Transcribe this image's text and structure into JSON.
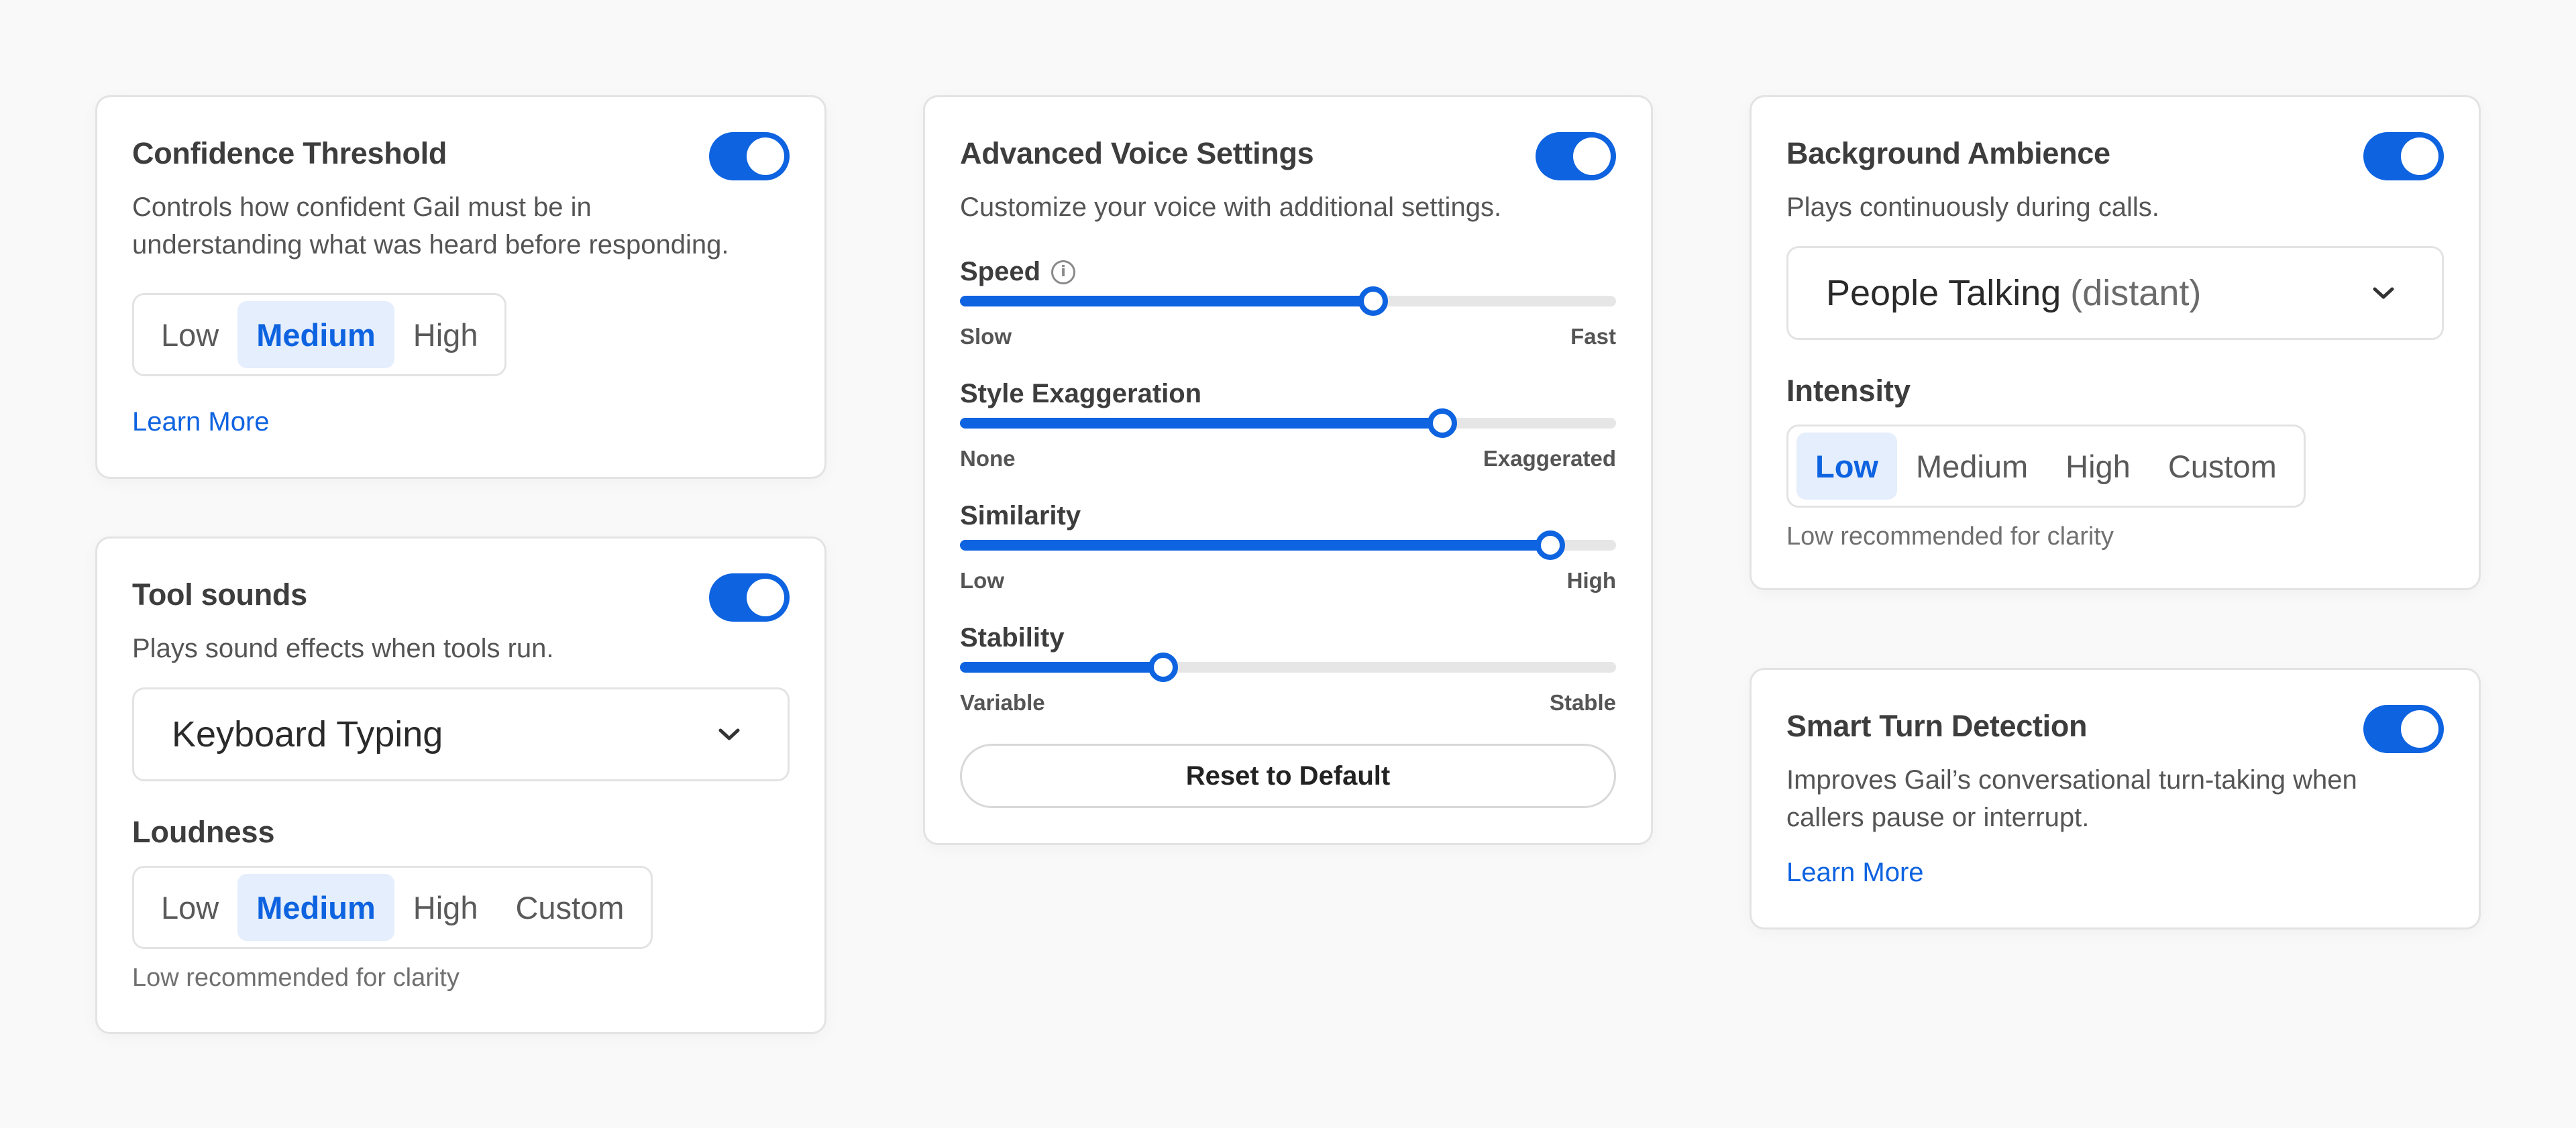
{
  "colors": {
    "accent": "#0e63e0",
    "accent_light": "#e4eefc",
    "background": "#f9f9f9",
    "card_border": "#e3e3e3"
  },
  "confidence": {
    "title": "Confidence Threshold",
    "enabled": true,
    "description": "Controls how confident Gail must be in\nunderstanding what was heard before responding.",
    "options": [
      "Low",
      "Medium",
      "High"
    ],
    "selected": "Medium",
    "learn_more": "Learn More"
  },
  "tool_sounds": {
    "title": "Tool sounds",
    "enabled": true,
    "description": "Plays sound effects when tools run.",
    "sound": "Keyboard Typing",
    "loudness_label": "Loudness",
    "loudness_options": [
      "Low",
      "Medium",
      "High",
      "Custom"
    ],
    "loudness_selected": "Medium",
    "hint": "Low recommended for clarity"
  },
  "voice": {
    "title": "Advanced Voice Settings",
    "enabled": true,
    "description": "Customize your voice with additional settings.",
    "sliders": [
      {
        "label": "Speed",
        "info_icon": true,
        "min_label": "Slow",
        "max_label": "Fast",
        "value": 0.63
      },
      {
        "label": "Style Exaggeration",
        "info_icon": false,
        "min_label": "None",
        "max_label": "Exaggerated",
        "value": 0.735
      },
      {
        "label": "Similarity",
        "info_icon": false,
        "min_label": "Low",
        "max_label": "High",
        "value": 0.9
      },
      {
        "label": "Stability",
        "info_icon": false,
        "min_label": "Variable",
        "max_label": "Stable",
        "value": 0.31
      }
    ],
    "reset_label": "Reset to Default"
  },
  "ambience": {
    "title": "Background Ambience",
    "enabled": true,
    "description": "Plays continuously during calls.",
    "sound": "People Talking",
    "sound_qualifier": "(distant)",
    "intensity_label": "Intensity",
    "intensity_options": [
      "Low",
      "Medium",
      "High",
      "Custom"
    ],
    "intensity_selected": "Low",
    "hint": "Low recommended for clarity"
  },
  "turn_detection": {
    "title": "Smart Turn Detection",
    "enabled": true,
    "description": "Improves Gail’s conversational turn-taking when\ncallers pause or interrupt.",
    "learn_more": "Learn More"
  }
}
